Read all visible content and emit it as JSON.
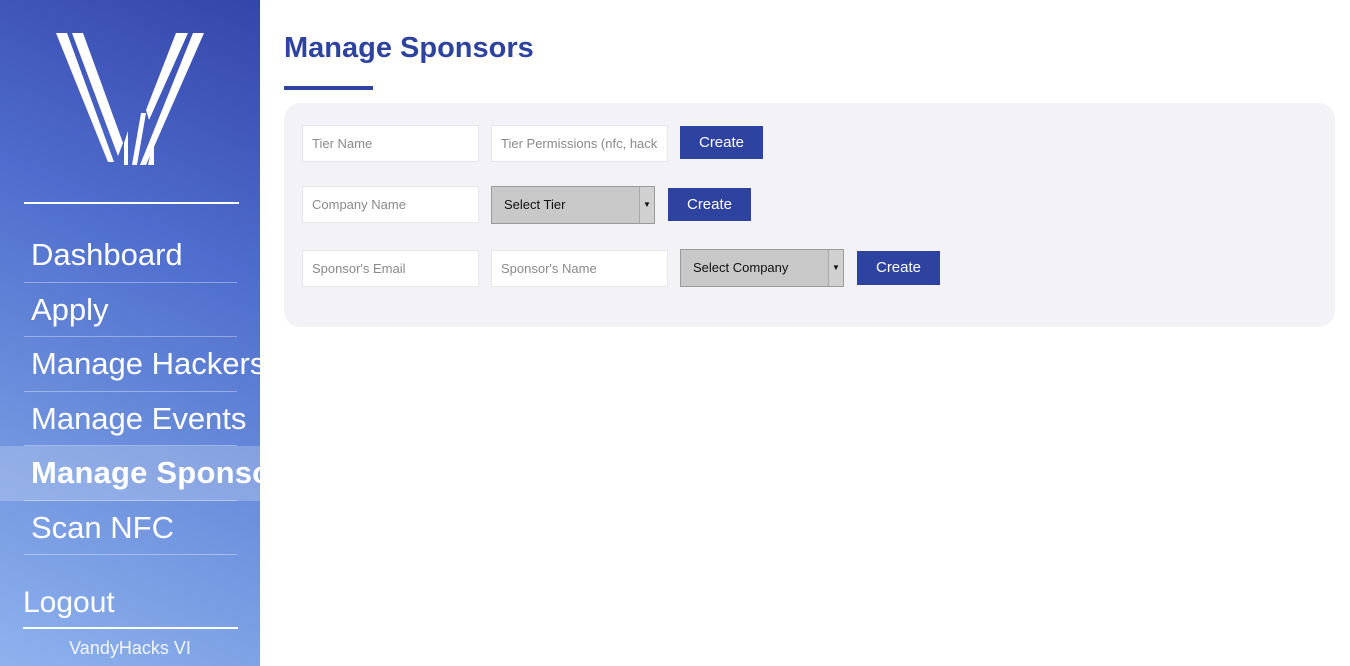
{
  "sidebar": {
    "nav": [
      {
        "label": "Dashboard"
      },
      {
        "label": "Apply"
      },
      {
        "label": "Manage Hackers"
      },
      {
        "label": "Manage Events"
      },
      {
        "label": "Manage Sponsors",
        "active": true
      },
      {
        "label": "Scan NFC"
      }
    ],
    "logout_label": "Logout",
    "footer": "VandyHacks VI"
  },
  "main": {
    "title": "Manage Sponsors",
    "tier_form": {
      "tier_name_placeholder": "Tier Name",
      "tier_permissions_placeholder": "Tier Permissions (nfc, hackers)",
      "create_label": "Create"
    },
    "company_form": {
      "company_name_placeholder": "Company Name",
      "select_tier_value": "Select Tier",
      "create_label": "Create"
    },
    "sponsor_form": {
      "sponsor_email_placeholder": "Sponsor's Email",
      "sponsor_name_placeholder": "Sponsor's Name",
      "select_company_value": "Select Company",
      "create_label": "Create"
    }
  },
  "colors": {
    "accent": "#2e43a0",
    "panel_background": "#f3f2f7",
    "sidebar_gradient_start": "#8fb2ee",
    "sidebar_gradient_end": "#3445a8"
  },
  "icons": {
    "logo": "vandyhacks-vi-logo",
    "dropdown_caret": "caret-down-icon"
  }
}
